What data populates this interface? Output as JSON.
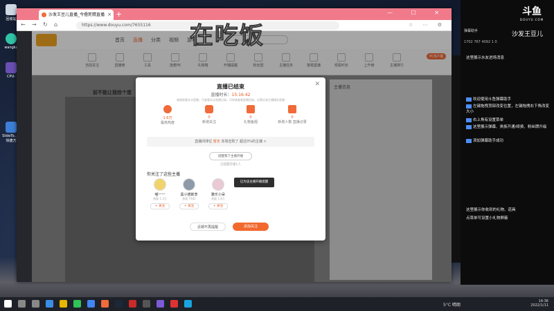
{
  "desktop": {
    "icons": [
      {
        "label": "回收站"
      },
      {
        "label": "wangka"
      },
      {
        "label": "CPU-"
      },
      {
        "label": "SlideTo… -快捷方"
      }
    ]
  },
  "browser": {
    "tab_title": "沙发王豆儿直播_今撸死精直播",
    "url": "https://www.douyu.com/7655116",
    "window_controls": "— ☐ ✕"
  },
  "overlay_title": "在吃饭",
  "site": {
    "nav": [
      "首页",
      "直播",
      "分类",
      "视频",
      "游戏"
    ],
    "categories": [
      "当前关注",
      "直播榜",
      "工具",
      "连麦PK",
      "礼物墙",
      "开播提醒",
      "粉丝团",
      "主播任务",
      "答题直播",
      "观看时长",
      "上升榜",
      "主播排行"
    ],
    "anchor_title": "前不能让我捡个蛋",
    "right_panel_label": "主播信息",
    "pcbar_label": "PCB户端"
  },
  "modal": {
    "title": "直播已结束",
    "duration_label": "直播时长：",
    "duration_value": "15:16:42",
    "notice": "感谢观看本次直播，可查看本次直播记录，可申请查看直播回放，近期记录主播精彩直播",
    "stats": [
      {
        "value": "1.6万",
        "label": "最高热度"
      },
      {
        "value": "0",
        "label": "新增关注"
      },
      {
        "value": "0",
        "label": "礼物鱼翅"
      },
      {
        "value": "0",
        "label": "新增人数 直播记录"
      }
    ],
    "rank_text": "直播间排位",
    "rank_value": "暂无",
    "rank_suffix": "本场击败了 超过0%的主播 >",
    "notify_button": "提醒我下主播开播",
    "notified_text": "已提醒开播1人",
    "follow_title": "你关注了这些主播",
    "anchors": [
      {
        "name": "喵一一",
        "hot": "热度 1.3万",
        "follow": "+ 关注"
      },
      {
        "name": "黑小德斯李",
        "hot": "热度 7942",
        "follow": "+ 关注"
      },
      {
        "name": "雅乐小朵",
        "hot": "热度 1.8万",
        "follow": "+ 关注"
      }
    ],
    "toast": "已为该主播开播提醒",
    "dismiss_button": "近期不再提醒",
    "follow_button": "添加关注"
  },
  "overlay_panel": {
    "logo": "斗鱼",
    "logo_sub": "DOUYU.COM",
    "streamer": "沙发王豆儿",
    "assistant": "弹幕助手",
    "stats": "1702  767  4092  1  0",
    "chat": [
      "这里展示水友进场消息",
      "欢迎使用斗鱼弹幕助手",
      "左键拖拽顶部改变位置，左键拖拽右下角改变大小",
      "右上角有设置菜单",
      "这里展示弹幕、贵族开通/续费、粉丝牌升级",
      "添加弹幕助手成功",
      "这里展示你收到的礼物、道具",
      "点菜单可设置小礼物屏蔽"
    ]
  },
  "taskbar": {
    "weather": "5°C 晴朗",
    "time": "14:36",
    "date": "2022/1/11"
  }
}
